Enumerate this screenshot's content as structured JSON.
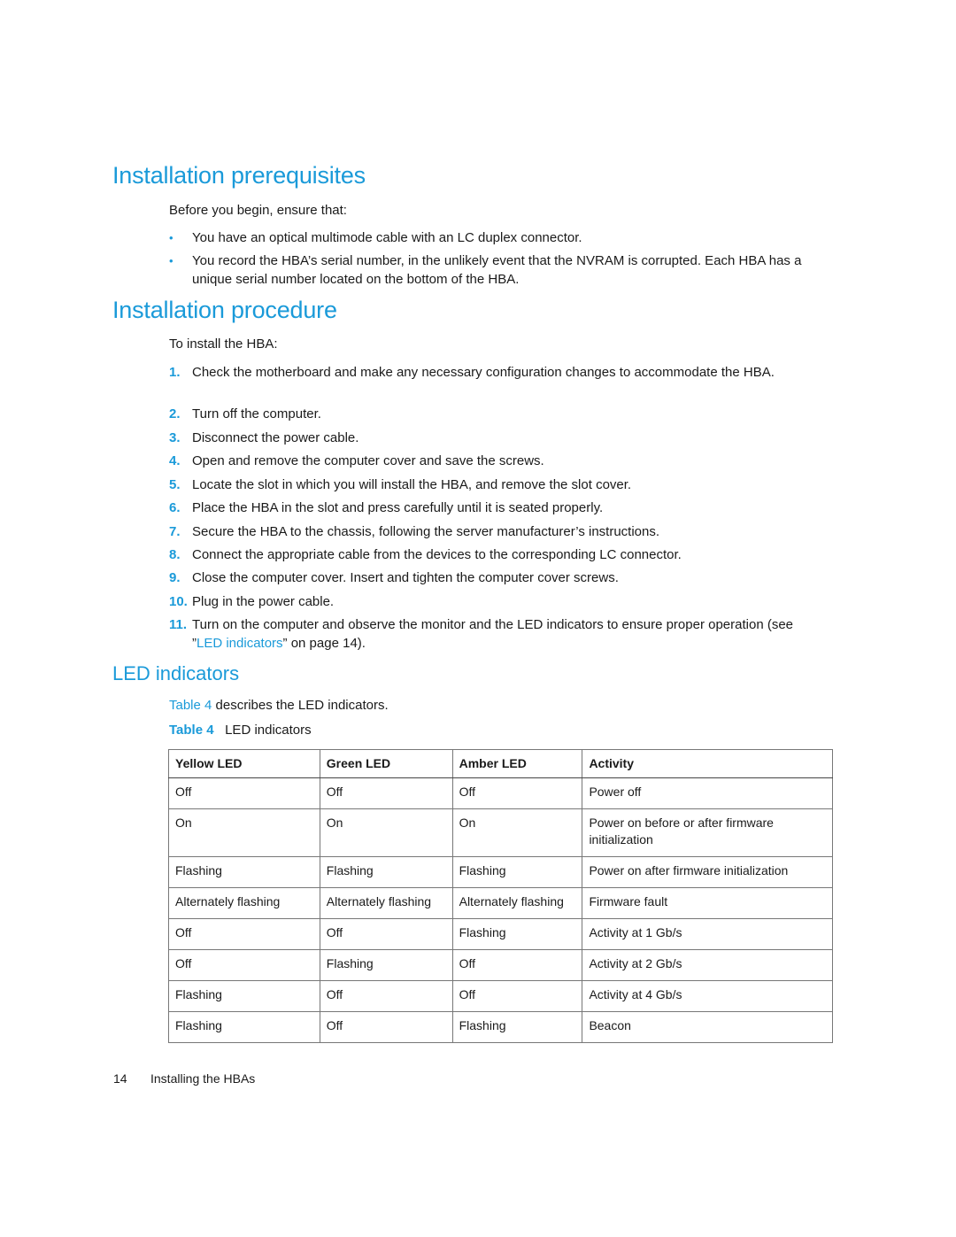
{
  "prereq": {
    "heading": "Installation prerequisites",
    "intro": "Before you begin, ensure that:",
    "bullet_glyph": "•",
    "bullets": [
      "You have an optical multimode cable with an LC duplex connector.",
      "You record the HBA’s serial number, in the unlikely event that the NVRAM is corrupted. Each HBA has a unique serial number located on the bottom of the HBA."
    ]
  },
  "procedure": {
    "heading": "Installation procedure",
    "intro": "To install the HBA:",
    "steps": [
      {
        "num": "1.",
        "text": "Check the motherboard and make any necessary configuration changes to accommodate the HBA."
      },
      {
        "num": "2.",
        "text": "Turn off the computer."
      },
      {
        "num": "3.",
        "text": "Disconnect the power cable."
      },
      {
        "num": "4.",
        "text": "Open and remove the computer cover and save the screws."
      },
      {
        "num": "5.",
        "text": "Locate the slot in which you will install the HBA, and remove the slot cover."
      },
      {
        "num": "6.",
        "text": "Place the HBA in the slot and press carefully until it is seated properly."
      },
      {
        "num": "7.",
        "text": "Secure the HBA to the chassis, following the server manufacturer’s instructions."
      },
      {
        "num": "8.",
        "text": "Connect the appropriate cable from the devices to the corresponding LC connector."
      },
      {
        "num": "9.",
        "text": "Close the computer cover. Insert and tighten the computer cover screws."
      },
      {
        "num": "10.",
        "text": "Plug in the power cable."
      },
      {
        "num": "11.",
        "text_before": "Turn on the computer and observe the monitor and the LED indicators to ensure proper operation (see ”",
        "link": "LED indicators",
        "text_after": "” on page 14)."
      }
    ]
  },
  "led": {
    "heading": "LED indicators",
    "ref_link": "Table 4",
    "ref_text": " describes the LED indicators.",
    "caption_label": "Table 4",
    "caption_text": "LED indicators",
    "table": {
      "headers": [
        "Yellow LED",
        "Green LED",
        "Amber LED",
        "Activity"
      ],
      "rows": [
        [
          "Off",
          "Off",
          "Off",
          "Power off"
        ],
        [
          "On",
          "On",
          "On",
          "Power on before or after firmware initialization"
        ],
        [
          "Flashing",
          "Flashing",
          "Flashing",
          "Power on after firmware initialization"
        ],
        [
          "Alternately flashing",
          "Alternately flashing",
          "Alternately flashing",
          "Firmware fault"
        ],
        [
          "Off",
          "Off",
          "Flashing",
          "Activity at 1 Gb/s"
        ],
        [
          "Off",
          "Flashing",
          "Off",
          "Activity at 2 Gb/s"
        ],
        [
          "Flashing",
          "Off",
          "Off",
          "Activity at 4 Gb/s"
        ],
        [
          "Flashing",
          "Off",
          "Flashing",
          "Beacon"
        ]
      ]
    }
  },
  "footer": {
    "page_number": "14",
    "section": "Installing the HBAs"
  }
}
